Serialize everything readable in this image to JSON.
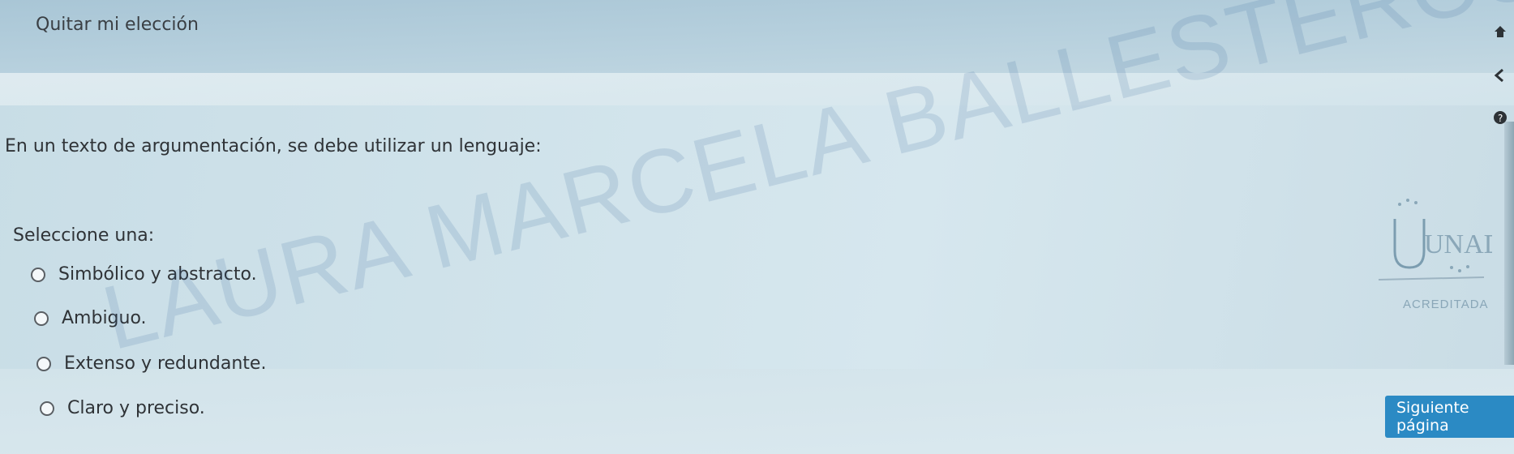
{
  "header": {
    "remove_choice_label": "Quitar mi elección"
  },
  "question": {
    "text": "En un texto de argumentación, se debe utilizar un lenguaje:",
    "prompt": "Seleccione una:",
    "options": [
      {
        "label": "Simbólico y abstracto."
      },
      {
        "label": "Ambiguo."
      },
      {
        "label": "Extenso y redundante."
      },
      {
        "label": "Claro y preciso."
      }
    ]
  },
  "navigation": {
    "next_page_label": "Siguiente página"
  },
  "watermark": {
    "text": "LAURA MARCELA BALLESTEROS LOPEZ"
  },
  "logo": {
    "name": "UNAD",
    "subtitle": "ACREDITADA"
  },
  "icons": {
    "home": "home-icon",
    "back": "back-arrow-icon",
    "help": "help-icon"
  },
  "colors": {
    "primary_button": "#2b8ac4"
  }
}
